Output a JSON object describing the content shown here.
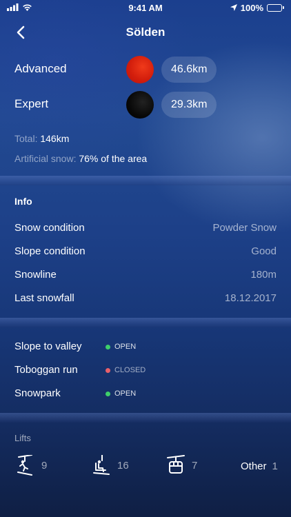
{
  "status_bar": {
    "time": "9:41 AM",
    "battery": "100%",
    "battery_level": 1.0,
    "icons": [
      "cellular-signal-icon",
      "wifi-icon",
      "location-arrow-icon",
      "battery-icon"
    ]
  },
  "nav": {
    "title": "Sölden",
    "back_icon": "chevron-left-icon"
  },
  "runs": [
    {
      "label": "Advanced",
      "length": "46.6km",
      "color": "#e0240e"
    },
    {
      "label": "Expert",
      "length": "29.3km",
      "color": "#000000"
    }
  ],
  "summary": {
    "total_label": "Total:",
    "total_value": "146km",
    "snow_label": "Artificial snow:",
    "snow_value": "76% of the area"
  },
  "info": {
    "title": "Info",
    "rows": [
      {
        "label": "Snow condition",
        "value": "Powder Snow"
      },
      {
        "label": "Slope condition",
        "value": "Good"
      },
      {
        "label": "Snowline",
        "value": "180m"
      },
      {
        "label": "Last snowfall",
        "value": "18.12.2017"
      }
    ]
  },
  "facilities": [
    {
      "label": "Slope to valley",
      "status": "OPEN",
      "color": "#3ecf6a"
    },
    {
      "label": "Toboggan run",
      "status": "CLOSED",
      "color": "#e8606a"
    },
    {
      "label": "Snowpark",
      "status": "OPEN",
      "color": "#3ecf6a"
    }
  ],
  "lifts": {
    "title": "Lifts",
    "items": [
      {
        "icon": "drag-lift-icon",
        "count": "9"
      },
      {
        "icon": "chairlift-icon",
        "count": "16"
      },
      {
        "icon": "gondola-icon",
        "count": "7"
      },
      {
        "label": "Other",
        "count": "1"
      }
    ]
  }
}
